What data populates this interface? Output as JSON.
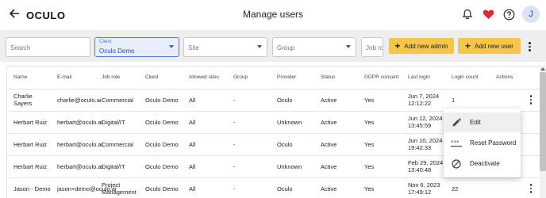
{
  "app": {
    "logo": "OCULO",
    "title": "Manage users",
    "avatar_initial": "J"
  },
  "filters": {
    "search_placeholder": "Search",
    "client_label": "Client",
    "client_value": "Oculo Demo",
    "site_placeholder": "Site",
    "group_placeholder": "Group",
    "jobrole_placeholder": "Job role",
    "add_admin_label": "Add new admin",
    "add_user_label": "Add new user"
  },
  "table": {
    "headers": [
      "Name",
      "E-mail",
      "Job role",
      "Client",
      "Allowed sites",
      "Group",
      "Provider",
      "Status",
      "GDPR consent",
      "Last login",
      "Login count",
      "Actions"
    ],
    "rows": [
      [
        "Charlie Sayers",
        "charlie@oculo.ai",
        "Commercial",
        "Oculo Demo",
        "All",
        "-",
        "Oculo",
        "Active",
        "Yes",
        "Jun 7, 2024 12:12:22",
        "1"
      ],
      [
        "Herbart Ruiz",
        "herbart@oculo.ai",
        "Digital/IT",
        "Oculo Demo",
        "All",
        "-",
        "Unknown",
        "Active",
        "Yes",
        "Jun 12, 2024 13:45:59",
        ""
      ],
      [
        "Herbart Ruiz",
        "herbart@oculo.ai",
        "Commercial",
        "Oculo Demo",
        "All",
        "-",
        "Oculo",
        "Active",
        "Yes",
        "Jun 10, 2024 19:42:33",
        ""
      ],
      [
        "Herbart Ruiz",
        "herbart@oculo.ai",
        "Digital/IT",
        "Oculo Demo",
        "All",
        "-",
        "Unknown",
        "Active",
        "Yes",
        "Feb 29, 2024 13:40:48",
        ""
      ],
      [
        "Jason - Demo",
        "jason+demo@oculo.ai",
        "Project Management",
        "Oculo Demo",
        "All",
        "-",
        "Oculo",
        "Active",
        "Yes",
        "Nov 6, 2023 17:49:12",
        "22"
      ]
    ]
  },
  "menu": {
    "edit_label": "Edit",
    "reset_label": "Reset Password",
    "deactivate_label": "Deactivate"
  },
  "colors": {
    "accent_button": "#f5c64a",
    "client_field_bg": "#e7efff",
    "client_border": "#4a7bd6",
    "heart": "#d92a35"
  }
}
